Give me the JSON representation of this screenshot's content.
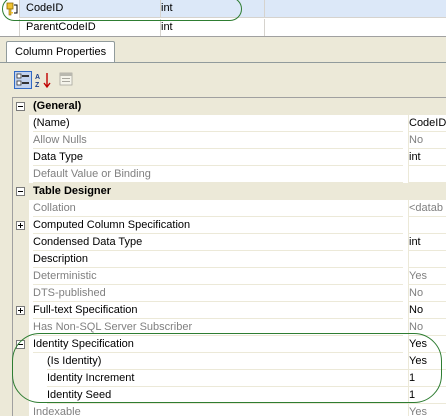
{
  "design_grid": {
    "rows": [
      {
        "name": "CodeID",
        "type": "int"
      },
      {
        "name": "ParentCodeID",
        "type": "int"
      }
    ]
  },
  "panel": {
    "tab_label": "Column Properties"
  },
  "properties": {
    "general_label": "(General)",
    "name_label": "(Name)",
    "name_value": "CodeID",
    "allow_nulls_label": "Allow Nulls",
    "allow_nulls_value": "No",
    "data_type_label": "Data Type",
    "data_type_value": "int",
    "default_value_label": "Default Value or Binding",
    "table_designer_label": "Table Designer",
    "collation_label": "Collation",
    "collation_value": "<datab",
    "computed_label": "Computed Column Specification",
    "condensed_label": "Condensed Data Type",
    "condensed_value": "int",
    "description_label": "Description",
    "deterministic_label": "Deterministic",
    "deterministic_value": "Yes",
    "dts_label": "DTS-published",
    "dts_value": "No",
    "fulltext_label": "Full-text Specification",
    "fulltext_value": "No",
    "nonsql_label": "Has Non-SQL Server Subscriber",
    "nonsql_value": "No",
    "identity_spec_label": "Identity Specification",
    "identity_spec_value": "Yes",
    "is_identity_label": "(Is Identity)",
    "is_identity_value": "Yes",
    "identity_increment_label": "Identity Increment",
    "identity_increment_value": "1",
    "identity_seed_label": "Identity Seed",
    "identity_seed_value": "1",
    "indexable_label": "Indexable",
    "indexable_value": "Yes"
  },
  "colors": {
    "annotation": "#2e7d32",
    "selection": "#dce8f8",
    "category_bg": "#ece9d8"
  }
}
